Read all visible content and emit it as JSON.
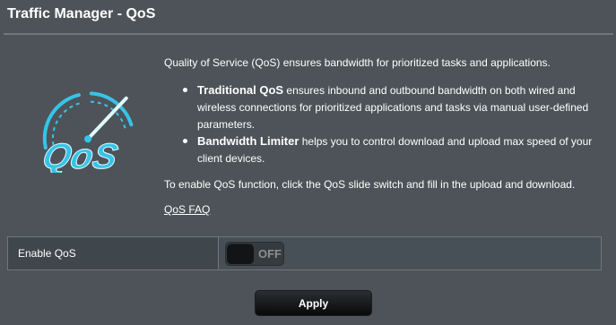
{
  "header": {
    "title": "Traffic Manager - QoS"
  },
  "description": {
    "intro": "Quality of Service (QoS) ensures bandwidth for prioritized tasks and applications.",
    "bullets": [
      {
        "title": "Traditional QoS",
        "text": " ensures inbound and outbound bandwidth on both wired and wireless connections for prioritized applications and tasks via manual user-defined parameters."
      },
      {
        "title": "Bandwidth Limiter",
        "text": " helps you to control download and upload max speed of your client devices."
      }
    ],
    "instruction": "To enable QoS function, click the QoS slide switch and fill in the upload and download.",
    "faq_link": "QoS FAQ"
  },
  "settings": {
    "enable_qos_label": "Enable QoS",
    "toggle_state": "OFF"
  },
  "actions": {
    "apply_label": "Apply"
  },
  "icons": {
    "logo": "qos-speedometer-icon"
  },
  "colors": {
    "background": "#4d5358",
    "accent_cyan": "#37c3e8",
    "button": "#0d0f10"
  }
}
